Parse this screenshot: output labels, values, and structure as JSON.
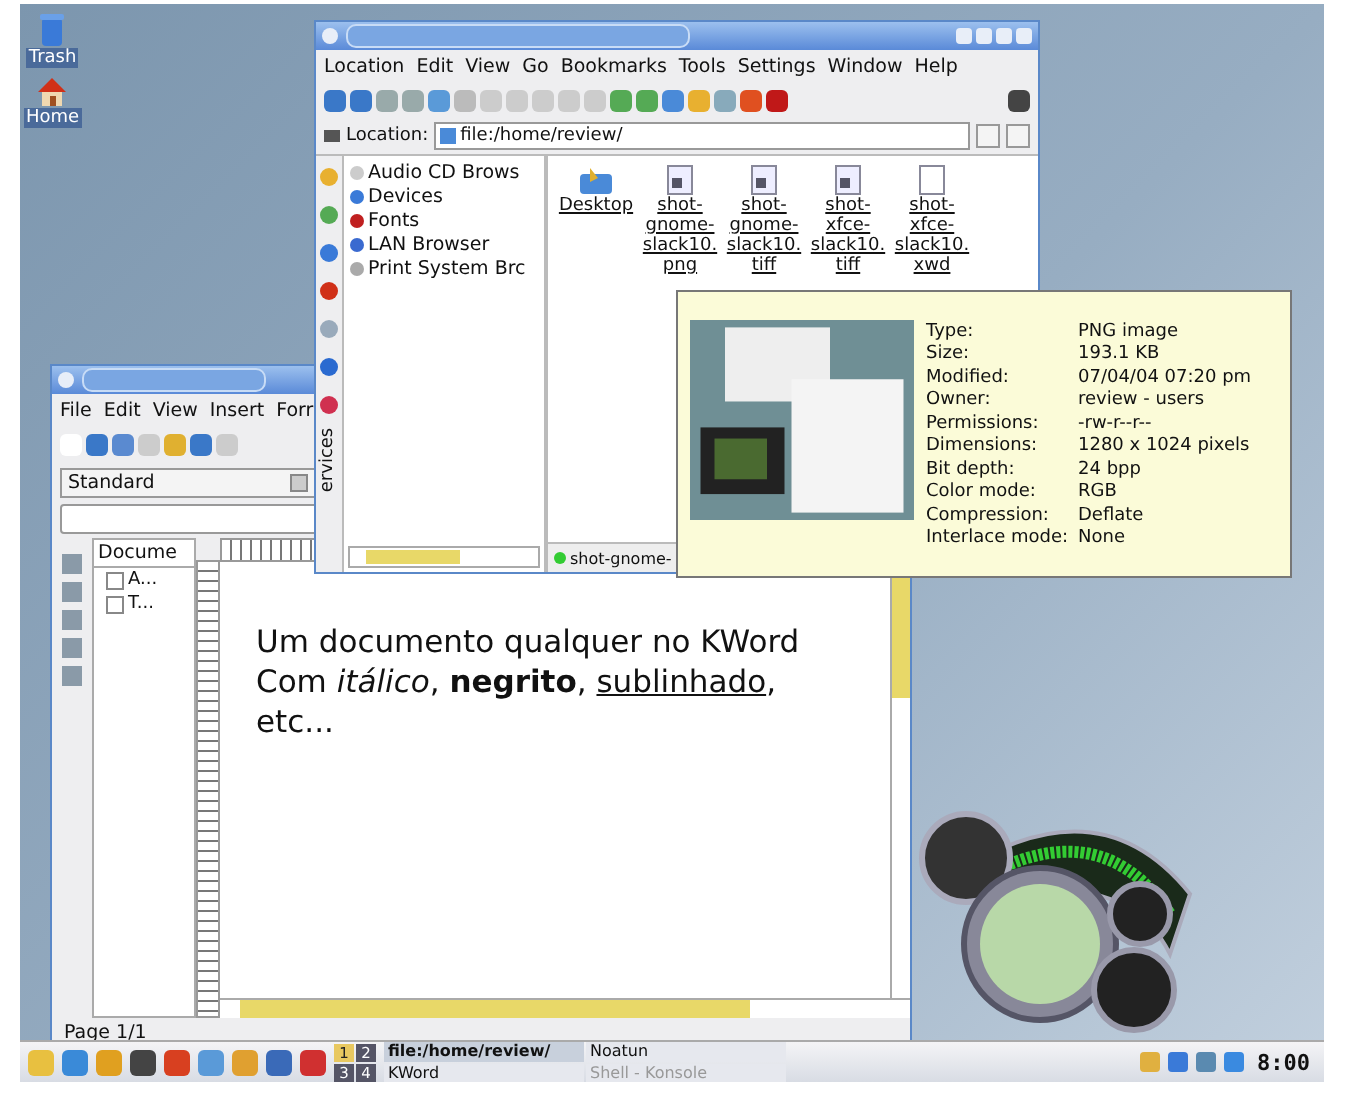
{
  "desktop_icons": [
    {
      "label": "Trash",
      "kind": "trash"
    },
    {
      "label": "Home",
      "kind": "home"
    }
  ],
  "konqueror": {
    "menu": [
      "Location",
      "Edit",
      "View",
      "Go",
      "Bookmarks",
      "Tools",
      "Settings",
      "Window",
      "Help"
    ],
    "location": {
      "label": "Location:",
      "value": "file:/home/review/"
    },
    "sidebar_tab": "ervices",
    "tree": [
      "Audio CD Brows",
      "Devices",
      "Fonts",
      "LAN Browser",
      "Print System Brc"
    ],
    "files": [
      {
        "label": "Desktop",
        "kind": "folder"
      },
      {
        "label": "shot-gnome-slack10.png",
        "kind": "image"
      },
      {
        "label": "shot-gnome-slack10.tiff",
        "kind": "image"
      },
      {
        "label": "shot-xfce-slack10.tiff",
        "kind": "image"
      },
      {
        "label": "shot-xfce-slack10.xwd",
        "kind": "document"
      }
    ],
    "status": "shot-gnome-"
  },
  "tooltip": {
    "rows": [
      {
        "label": "Type:",
        "value": "PNG image"
      },
      {
        "label": "Size:",
        "value": "193.1 KB"
      },
      {
        "label": "Modified:",
        "value": "07/04/04 07:20 pm"
      },
      {
        "label": "Owner:",
        "value": "review - users"
      },
      {
        "label": "Permissions:",
        "value": "-rw-r--r--"
      },
      {
        "label": "Dimensions:",
        "value": "1280 x 1024 pixels"
      },
      {
        "label": "Bit depth:",
        "value": "24 bpp"
      },
      {
        "label": "Color mode:",
        "value": "RGB"
      },
      {
        "label": "Compression:",
        "value": "Deflate"
      },
      {
        "label": "Interlace mode:",
        "value": "None"
      }
    ]
  },
  "kword": {
    "menu": [
      "File",
      "Edit",
      "View",
      "Insert",
      "Forr"
    ],
    "style": "Standard",
    "structure": {
      "header": "Docume",
      "items": [
        "A...",
        "T..."
      ]
    },
    "paragraphs": [
      [
        {
          "text": "Um documento qualquer no KWord",
          "kind": "plain"
        }
      ],
      [
        {
          "text": "Com ",
          "kind": "plain"
        },
        {
          "text": "itálico",
          "kind": "italic"
        },
        {
          "text": ", ",
          "kind": "plain"
        },
        {
          "text": "negrito",
          "kind": "bold"
        },
        {
          "text": ", ",
          "kind": "plain"
        },
        {
          "text": "sublinhado",
          "kind": "underline"
        },
        {
          "text": ", etc...",
          "kind": "plain"
        }
      ]
    ],
    "status": "Page 1/1"
  },
  "taskbar": {
    "pager": [
      {
        "label": "1",
        "selected": true
      },
      {
        "label": "2",
        "selected": false
      },
      {
        "label": "3",
        "selected": false
      },
      {
        "label": "4",
        "selected": false
      }
    ],
    "tasks": [
      {
        "label": "file:/home/review/",
        "selected": true,
        "minimized": false
      },
      {
        "label": "Noatun",
        "selected": false,
        "minimized": false
      },
      {
        "label": "KWord",
        "selected": false,
        "minimized": false
      },
      {
        "label": "Shell - Konsole",
        "selected": false,
        "minimized": true
      }
    ],
    "clock": "8:00"
  }
}
